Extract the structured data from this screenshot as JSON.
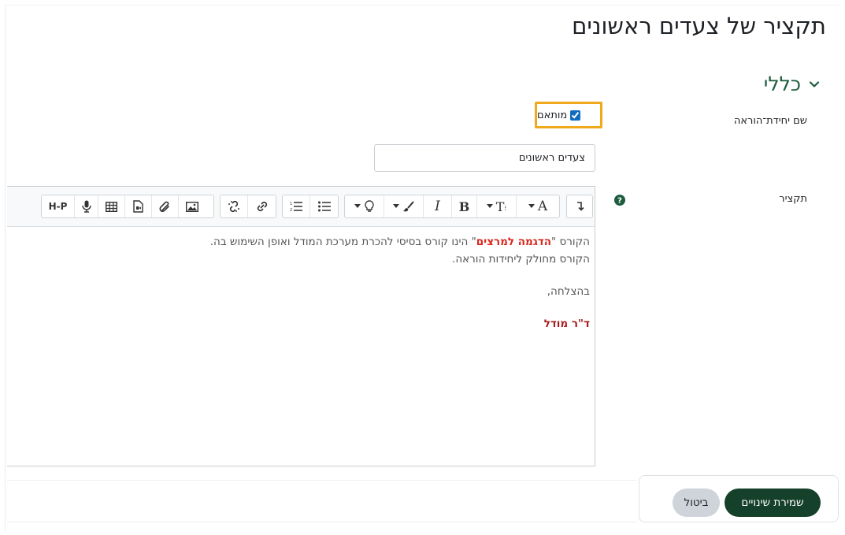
{
  "page": {
    "title": "תקציר של צעדים ראשונים"
  },
  "section": {
    "title": "כללי"
  },
  "fields": {
    "unit_name": {
      "label": "שם יחידת־הוראה",
      "custom_checkbox_label": "מותאם",
      "custom_checked": true,
      "value": "צעדים ראשונים"
    },
    "summary": {
      "label": "תקציר"
    }
  },
  "editor": {
    "toolbar": {
      "text_direction": "↵",
      "font_color": "A",
      "font_size": "T",
      "bold": "B",
      "italic": "I",
      "h5p": "H-P"
    },
    "content": {
      "line1_before": "הקורס \"",
      "line1_highlight": "הדגמה למרצים",
      "line1_after": "\" הינו קורס בסיסי להכרת מערכת המודל ואופן השימוש בה.",
      "line2": "הקורס מחולק ליחידות הוראה.",
      "line3": "בהצלחה,",
      "signature": "ד\"ר מודל"
    }
  },
  "buttons": {
    "save": "שמירת שינויים",
    "cancel": "ביטול"
  },
  "colors": {
    "accent": "#15402a",
    "highlight_box": "#f0a81c",
    "help": "#1d5c3e"
  }
}
